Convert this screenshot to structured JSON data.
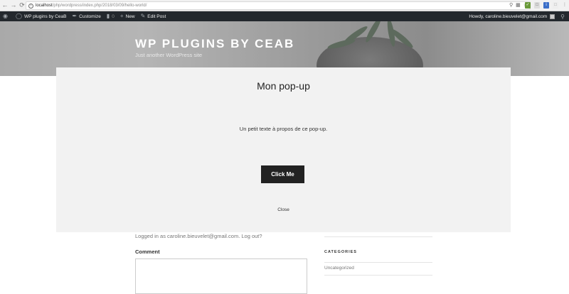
{
  "browser": {
    "url_host": "localhost",
    "url_path": "/php/wordpress/index.php/2018/03/09/hello-world/"
  },
  "admin_bar": {
    "site_name": "WP plugins by CeaB",
    "customize": "Customize",
    "comments_count": "0",
    "new": "New",
    "edit_post": "Edit Post",
    "howdy": "Howdy, caroline.bieuvelet@gmail.com"
  },
  "header": {
    "title": "WP PLUGINS BY CEAB",
    "description": "Just another WordPress site"
  },
  "page": {
    "logged_in": "Logged in as caroline.bieuvelet@gmail.com. Log out?",
    "comment_label": "Comment",
    "categories_heading": "CATEGORIES",
    "category_item": "Uncategorized"
  },
  "modal": {
    "title": "Mon pop-up",
    "text": "Un petit texte à propos de ce pop-up.",
    "button_label": "Click Me",
    "close_label": "Close"
  },
  "colors": {
    "admin_bar_bg": "#23282d",
    "modal_bg": "#f2f2f2",
    "button_bg": "#222222"
  },
  "icons": [
    "back-icon",
    "forward-icon",
    "reload-icon",
    "info-icon",
    "zoom-icon",
    "star-icon",
    "wordpress-icon",
    "customize-icon",
    "comment-icon",
    "plus-icon",
    "pencil-icon",
    "search-icon"
  ]
}
